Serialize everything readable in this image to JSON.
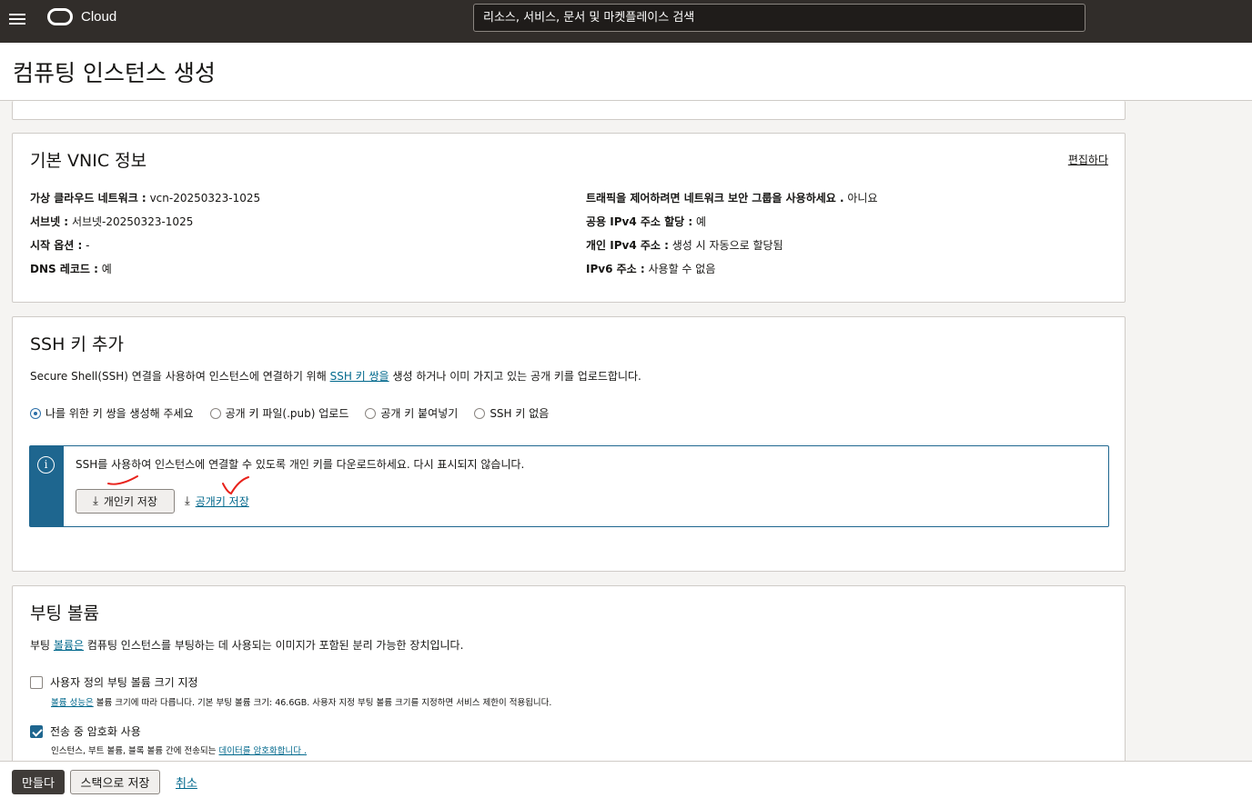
{
  "header": {
    "logo_text": "Cloud",
    "search_placeholder": "리소스, 서비스, 문서 및 마켓플레이스 검색"
  },
  "page": {
    "title": "컴퓨팅 인스턴스 생성"
  },
  "vnic": {
    "title": "기본 VNIC 정보",
    "edit_label": "편집하다",
    "left": [
      {
        "label": "가상 클라우드 네트워크 :",
        "value": "vcn-20250323-1025"
      },
      {
        "label": "서브넷 :",
        "value": "서브넷-20250323-1025"
      },
      {
        "label": "시작 옵션 :",
        "value": "-"
      },
      {
        "label": "DNS 레코드 :",
        "value": "예"
      }
    ],
    "right": [
      {
        "label": "트래픽을 제어하려면 네트워크 보안 그룹을 사용하세요 .",
        "value": "아니요"
      },
      {
        "label": "공용 IPv4 주소 할당 :",
        "value": "예"
      },
      {
        "label": "개인 IPv4 주소 :",
        "value": "생성 시 자동으로 할당됨"
      },
      {
        "label": "IPv6 주소 :",
        "value": "사용할 수 없음"
      }
    ]
  },
  "ssh": {
    "title": "SSH 키 추가",
    "desc_before": "Secure Shell(SSH) 연결을 사용하여 인스턴스에 연결하기 위해",
    "desc_link": "SSH 키 쌍을",
    "desc_after": "생성 하거나 이미 가지고 있는 공개 키를 업로드합니다.",
    "options": [
      {
        "label": "나를 위한 키 쌍을 생성해 주세요",
        "checked": true
      },
      {
        "label": "공개 키 파일(.pub) 업로드",
        "checked": false
      },
      {
        "label": "공개 키 붙여넣기",
        "checked": false
      },
      {
        "label": "SSH 키 없음",
        "checked": false
      }
    ],
    "info_text": "SSH를 사용하여 인스턴스에 연결할 수 있도록 개인 키를 다운로드하세요. 다시 표시되지 않습니다.",
    "save_private_label": "개인키 저장",
    "save_public_label": "공개키 저장",
    "annotation_color": "#e8221b"
  },
  "boot": {
    "title": "부팅 볼륨",
    "desc_before": "부팅",
    "desc_link": "볼륨은",
    "desc_after": "컴퓨팅 인스턴스를 부팅하는 데 사용되는 이미지가 포함된 분리 가능한 장치입니다.",
    "custom_size_label": "사용자 정의 부팅 볼륨 크기 지정",
    "custom_size_checked": false,
    "custom_note_link": "볼륨 성능은",
    "custom_note_text": "볼륨 크기에 따라 다릅니다. 기본 부팅 볼륨 크기: 46.6GB. 사용자 지정 부팅 볼륨 크기를 지정하면 서비스 제한이 적용됩니다.",
    "encrypt_label": "전송 중 암호화 사용",
    "encrypt_checked": true,
    "encrypt_note_text": "인스턴스, 부트 볼륨, 블록 볼륨 간에 전송되는",
    "encrypt_note_link": "데이터를 암호화합니다 ."
  },
  "footer": {
    "create_label": "만들다",
    "stack_label": "스택으로 저장",
    "cancel_label": "취소"
  },
  "colors": {
    "topbar": "#312d2a",
    "accent": "#1e668f",
    "link": "#00688c"
  }
}
